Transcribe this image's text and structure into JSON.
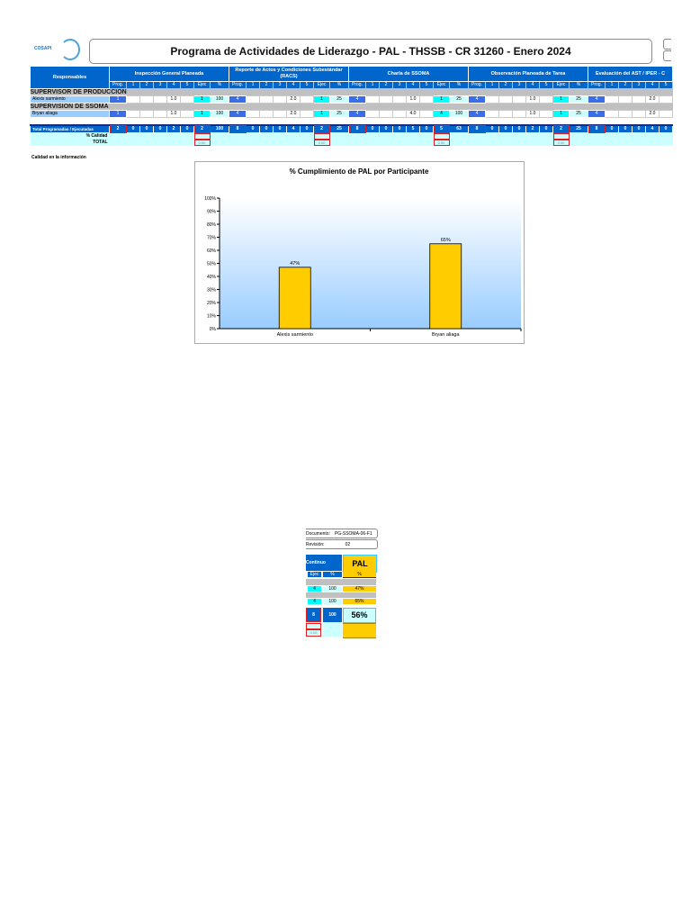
{
  "header": {
    "logo_text": "COSAPI",
    "title": "Programa de Actividades de Liderazgo - PAL - THSSB - CR 31260 - Enero 2024"
  },
  "grid": {
    "responsables_label": "Responsables",
    "subcols": [
      "Prog.",
      "1",
      "2",
      "3",
      "4",
      "5",
      "Ejec",
      "%"
    ],
    "groups": [
      "SUPERVISOR DE PRODUCCIÓN",
      "SUPERVISIÓN DE SSOMA"
    ],
    "people": [
      "Alexis sarmiento",
      "Bryan aliaga"
    ],
    "total_label": "Total Programadas / Ejecutadas",
    "calidad_label": "% Calidad",
    "total2_label": "TOTAL",
    "sections": [
      {
        "title": "Inspección General Planeada",
        "rows": [
          [
            "1",
            "",
            "",
            "",
            "1.0",
            "",
            "1",
            "100"
          ],
          [
            "1",
            "",
            "",
            "",
            "1.0",
            "",
            "1",
            "100"
          ]
        ],
        "total": [
          "2",
          "0",
          "0",
          "0",
          "2",
          "0",
          "2",
          "100"
        ],
        "final": "0.00"
      },
      {
        "title": "Reporte de Actos y Condiciones Subestándar (RACS)",
        "rows": [
          [
            "4",
            "",
            "",
            "",
            "2.0",
            "",
            "1",
            "25"
          ],
          [
            "4",
            "",
            "",
            "",
            "2.0",
            "",
            "1",
            "25"
          ]
        ],
        "total": [
          "8",
          "0",
          "0",
          "0",
          "4",
          "0",
          "2",
          "25"
        ],
        "final": "0.00"
      },
      {
        "title": "Charla de SSOMA",
        "rows": [
          [
            "4",
            "",
            "",
            "",
            "1.0",
            "",
            "1",
            "25"
          ],
          [
            "4",
            "",
            "",
            "",
            "4.0",
            "",
            "4",
            "100"
          ]
        ],
        "total": [
          "8",
          "0",
          "0",
          "0",
          "5",
          "0",
          "5",
          "63"
        ],
        "final": "0.00"
      },
      {
        "title": "Observación Planeada de Tarea",
        "rows": [
          [
            "4",
            "",
            "",
            "",
            "1.0",
            "",
            "1",
            "25"
          ],
          [
            "4",
            "",
            "",
            "",
            "1.0",
            "",
            "1",
            "25"
          ]
        ],
        "total": [
          "8",
          "0",
          "0",
          "0",
          "2",
          "0",
          "2",
          "25"
        ],
        "final": "0.00"
      },
      {
        "title": "Evaluación del AST / IPER - C",
        "rows": [
          [
            "4",
            "",
            "",
            "",
            "2.0",
            ""
          ],
          [
            "4",
            "",
            "",
            "",
            "2.0",
            ""
          ]
        ],
        "total": [
          "8",
          "0",
          "0",
          "0",
          "4",
          "0"
        ],
        "final": ""
      }
    ]
  },
  "calidad_info": "Calidad en la información",
  "chart_data": {
    "type": "bar",
    "title": "% Cumplimiento de PAL por Participante",
    "categories": [
      "Alexis sarmiento",
      "Bryan aliaga"
    ],
    "values": [
      47,
      65
    ],
    "data_labels": [
      "47%",
      "65%"
    ],
    "ylim": [
      0,
      100
    ],
    "yticks": [
      "0%",
      "10%",
      "20%",
      "30%",
      "40%",
      "50%",
      "60%",
      "70%",
      "80%",
      "90%",
      "100%"
    ],
    "bar_color": "#ffcc00"
  },
  "fragment": {
    "documento_label": "Documento:",
    "documento_value": "PG-SSOMA-06-F1",
    "revision_label": "Revisión:",
    "revision_value": "02",
    "continuo_label": "Continuo",
    "pal_label": "PAL",
    "subcols": [
      "Ejec",
      "%",
      "%"
    ],
    "rows": [
      [
        "4",
        "100",
        "47%"
      ],
      [
        "4",
        "100",
        "65%"
      ]
    ],
    "total": [
      "8",
      "100",
      "56%"
    ],
    "final": "0.00"
  }
}
